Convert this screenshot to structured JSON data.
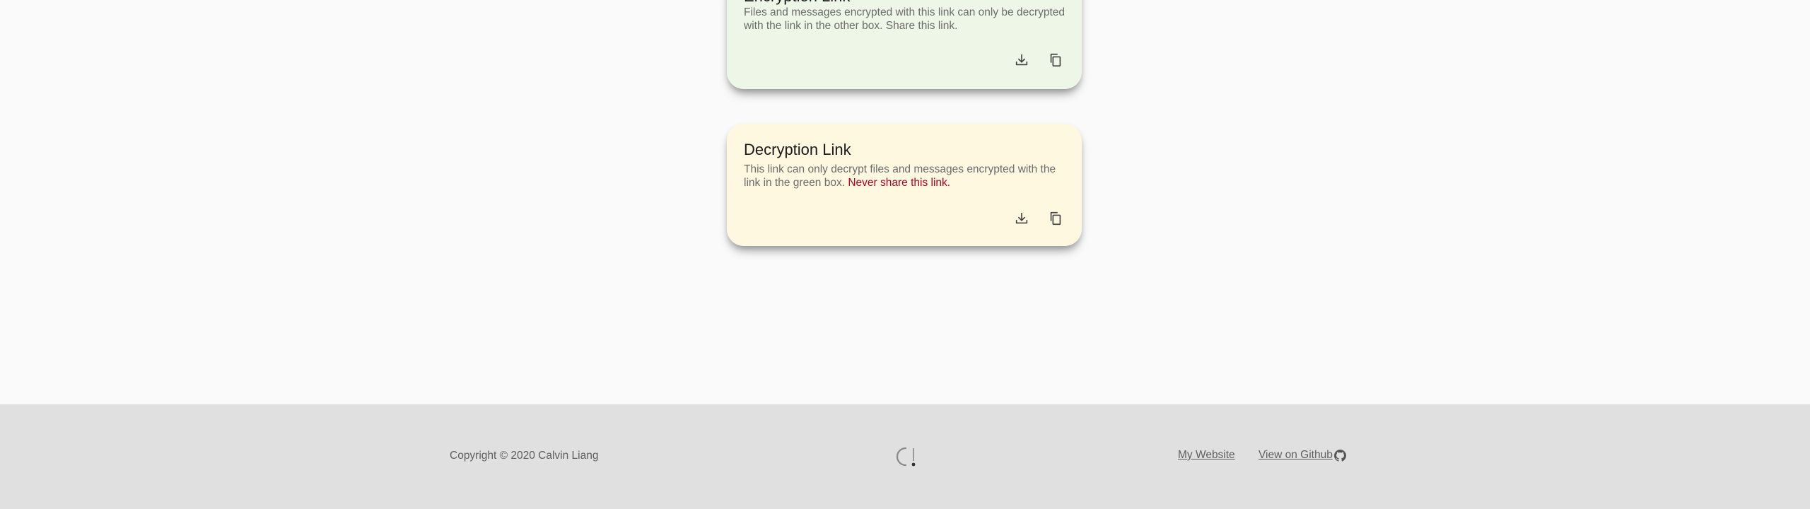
{
  "cards": {
    "encryption": {
      "title": "Encryption Link",
      "description": "Files and messages encrypted with this link can only be decrypted with the link in the other box. Share this link.",
      "background": "#eef6e8"
    },
    "decryption": {
      "title": "Decryption Link",
      "description": "This link can only decrypt files and messages encrypted with the link in the green box.",
      "warning": "Never share this link.",
      "warning_color": "#b00020",
      "background": "#fff8e1"
    },
    "actions": {
      "download_icon": "download-icon",
      "copy_icon": "copy-icon"
    }
  },
  "footer": {
    "copyright": "Copyright © 2020 Calvin Liang",
    "logo": "logo-icon",
    "links": {
      "website": "My Website",
      "github": "View on Github"
    },
    "github_icon": "github-icon",
    "background": "#e0e0e0"
  }
}
